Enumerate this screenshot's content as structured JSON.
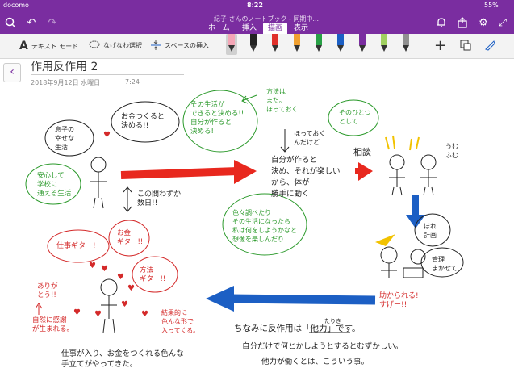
{
  "status": {
    "carrier": "docomo",
    "time": "8:22",
    "battery": "55%"
  },
  "title_bar": {
    "doc_title": "紀子 さんのノートブック - 同期中..."
  },
  "tabs": [
    "ホーム",
    "挿入",
    "描画",
    "表示"
  ],
  "active_tab": "描画",
  "toolbar": {
    "text_mode": "テキスト モード",
    "lasso": "なげなわ選択",
    "space": "スペースの挿入"
  },
  "pens": [
    {
      "color": "#f4a6b6"
    },
    {
      "color": "#222222"
    },
    {
      "color": "#e0302b"
    },
    {
      "color": "#f0a030"
    },
    {
      "color": "#28a046"
    },
    {
      "color": "#1c5fc4"
    },
    {
      "color": "#7a2da0"
    },
    {
      "color": "#a0d060"
    },
    {
      "color": "#909090"
    }
  ],
  "page": {
    "title": "作用反作用 2",
    "date": "2018年9月12日 水曜日",
    "time": "7:24"
  },
  "notes": {
    "n1": "息子の\n幸せな\n生活",
    "n2": "お金つくると\n決める!!",
    "n3": "その生活が\nできると決める!!\n自分が作ると\n決める!!",
    "n4": "方法は\nまだ。\nほっておく",
    "n5": "ほっておく\nんだけど",
    "n6": "自分が作ると\n決め、それが楽しい\nから、体が\n勝手に動く",
    "n7": "そのひとつ\nとして",
    "n8": "相談",
    "n9": "うむ\nふむ",
    "n10": "安心して\n学校に\n通える生活",
    "n11": "この間わずか\n数日!!",
    "n12": "色々調べたり\nその生活になったら\n私は何をしようかなと\n想像を楽しんだり",
    "n13": "ほれ\n計画",
    "n14": "管理\nまかせて",
    "n15": "仕事ギター!",
    "n16": "お金\nギター!!",
    "n17": "方法\nギター!!",
    "n18": "ありが\nとう!!",
    "n19": "自然に感謝\nが生まれる。",
    "n20": "結果的に\n色んな形で\n入ってくる。",
    "n21": "助かられる!!\nすげー!!",
    "n22": "たりき",
    "n23": "ちなみに反作用は「他力」です。",
    "n24": "自分だけで何とかしようとするとむずかしい。",
    "n25": "他力が働くとは、こういう事。",
    "n26": "仕事が入り、お金をつくれる色んな\n手立てがやってきた。"
  }
}
